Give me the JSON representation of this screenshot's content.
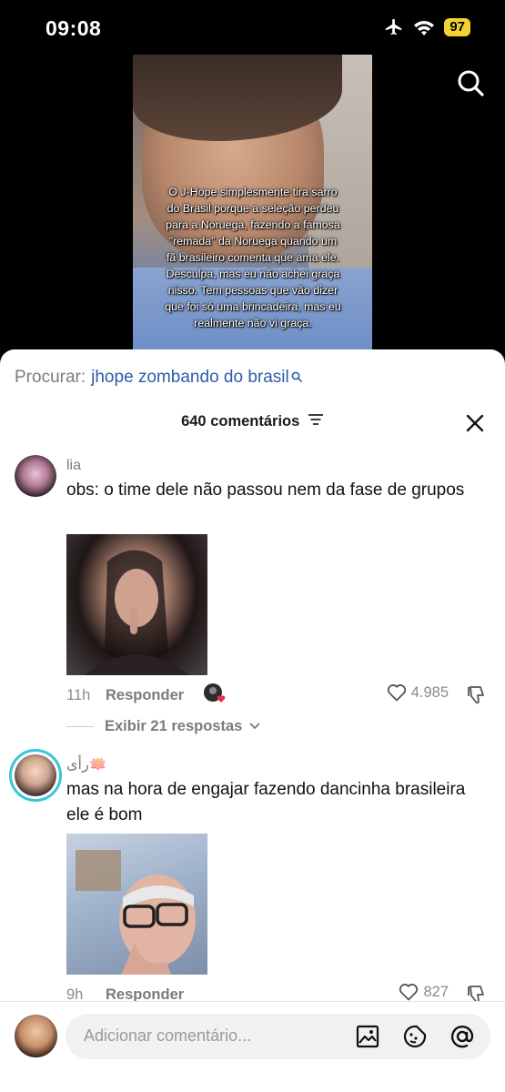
{
  "status_bar": {
    "time": "09:08",
    "battery": "97"
  },
  "video": {
    "caption": "O J-Hope simplesmente tira sarro do Brasil porque a seleção perdeu para a Noruega, fazendo a famosa \"remada\" da Noruega quando um fã brasileiro comenta que ama ele. Desculpa, mas eu não achei graça nisso. Tem pessoas que vão dizer que foi só uma brincadeira, mas eu realmente não vi graça."
  },
  "search": {
    "prefix": "Procurar:",
    "query": "jhope zombando do brasil"
  },
  "comments_header": {
    "count_label": "640 comentários"
  },
  "comments": [
    {
      "username": "lia",
      "text": "obs: o time dele não passou nem da fase de grupos",
      "time": "11h",
      "reply_label": "Responder",
      "likes": "4.985",
      "view_replies": "Exibir 21 respostas"
    },
    {
      "username": "رأى🪷",
      "text": "mas na hora de engajar fazendo dancinha brasileira ele é bom",
      "time": "9h",
      "reply_label": "Responder",
      "likes": "827"
    }
  ],
  "composer": {
    "placeholder": "Adicionar comentário..."
  },
  "colors": {
    "accent_link": "#2f5ba8",
    "battery": "#f1d22f",
    "story_ring": "#38c6d9",
    "creator_heart": "#f0284a"
  }
}
